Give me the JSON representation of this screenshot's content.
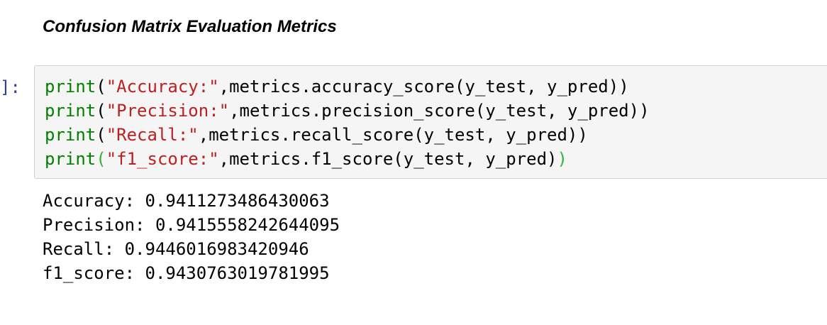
{
  "heading": "Confusion Matrix Evaluation Metrics",
  "prompt": "]:",
  "code": {
    "lines": [
      {
        "fn": "print",
        "open": "(",
        "str": "\"Accuracy:\"",
        "rest": ",metrics.accuracy_score(y_test, y_pred)",
        "close": ")"
      },
      {
        "fn": "print",
        "open": "(",
        "str": "\"Precision:\"",
        "rest": ",metrics.precision_score(y_test, y_pred)",
        "close": ")"
      },
      {
        "fn": "print",
        "open": "(",
        "str": "\"Recall:\"",
        "rest": ",metrics.recall_score(y_test, y_pred)",
        "close": ")"
      },
      {
        "fn": "print",
        "open": "(",
        "str": "\"f1_score:\"",
        "rest": ",metrics.f1_score(y_test, y_pred",
        "close": ")"
      }
    ]
  },
  "output": {
    "lines": [
      "Accuracy: 0.9411273486430063",
      "Precision: 0.9415558242644095",
      "Recall: 0.9446016983420946",
      "f1_score: 0.9430763019781995"
    ]
  },
  "colors": {
    "keyword": "#008000",
    "string": "#ba2121",
    "prompt": "#303f9f",
    "matched_paren": "#36b336",
    "cell_background": "#f5f5f5",
    "cell_border": "#cfcfcf"
  }
}
